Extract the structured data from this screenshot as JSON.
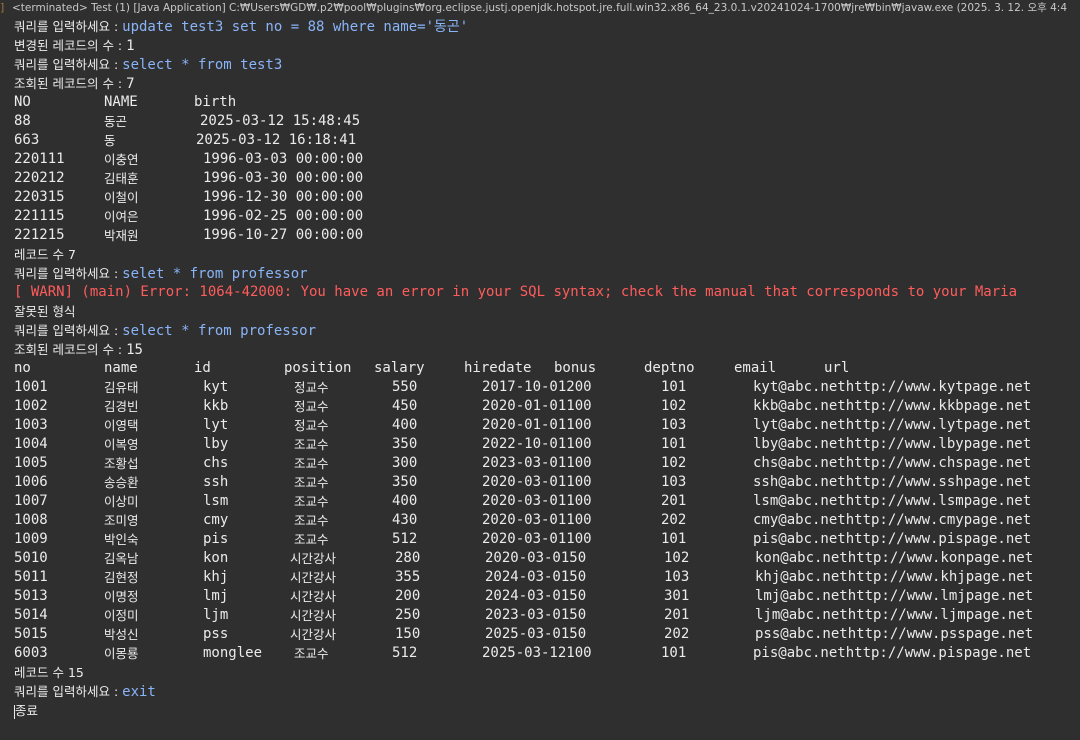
{
  "header": {
    "title": "<terminated> Test (1) [Java Application] C:₩Users₩GD₩.p2₩pool₩plugins₩org.eclipse.justj.openjdk.hotspot.jre.full.win32.x86_64_23.0.1.v20241024-1700₩jre₩bin₩javaw.exe  (2025. 3. 12. 오후 4:4"
  },
  "gutter": {
    "mark": "]"
  },
  "prompt_label": "쿼리를 입력하세요 : ",
  "update_block": {
    "query": "update test3 set no = 88 where name='동곤'",
    "changed_label": "변경된 레코드의 수 : ",
    "changed_count": "1"
  },
  "select_test3": {
    "query": "select * from test3",
    "count_label": "조회된 레코드의 수 : ",
    "count": "7",
    "headers": [
      "NO",
      "NAME",
      "birth"
    ],
    "rows": [
      [
        "88",
        "동곤",
        "2025-03-12 15:48:45"
      ],
      [
        "663",
        "동",
        "2025-03-12 16:18:41"
      ],
      [
        "220111",
        "이충연",
        "1996-03-03 00:00:00"
      ],
      [
        "220212",
        "김태훈",
        "1996-03-30 00:00:00"
      ],
      [
        "220315",
        "이철이",
        "1996-12-30 00:00:00"
      ],
      [
        "221115",
        "이여은",
        "1996-02-25 00:00:00"
      ],
      [
        "221215",
        "박재원",
        "1996-10-27 00:00:00"
      ]
    ],
    "footer": "레코드 수 7"
  },
  "error_block": {
    "query": "selet * from professor",
    "error": "[ WARN] (main) Error: 1064-42000: You have an error in your SQL syntax; check the manual that corresponds to your Maria",
    "message": "잘못된 형식"
  },
  "select_professor": {
    "query": "select * from professor",
    "count_label": "조회된 레코드의 수 : ",
    "count": "15",
    "headers": [
      "no",
      "name",
      "id",
      "position",
      "salary",
      "hiredate",
      "bonus",
      "deptno",
      "email",
      "url"
    ],
    "rows": [
      [
        "1001",
        "김유태",
        "kyt",
        "정교수",
        "550",
        "2017-10-01200",
        "101",
        "kyt@abc.nethttp://www.kytpage.net"
      ],
      [
        "1002",
        "김경빈",
        "kkb",
        "정교수",
        "450",
        "2020-01-01100",
        "102",
        "kkb@abc.nethttp://www.kkbpage.net"
      ],
      [
        "1003",
        "이영택",
        "lyt",
        "정교수",
        "400",
        "2020-01-01100",
        "103",
        "lyt@abc.nethttp://www.lytpage.net"
      ],
      [
        "1004",
        "이복영",
        "lby",
        "조교수",
        "350",
        "2022-10-01100",
        "101",
        "lby@abc.nethttp://www.lbypage.net"
      ],
      [
        "1005",
        "조황섭",
        "chs",
        "조교수",
        "300",
        "2023-03-01100",
        "102",
        "chs@abc.nethttp://www.chspage.net"
      ],
      [
        "1006",
        "송승환",
        "ssh",
        "조교수",
        "350",
        "2020-03-01100",
        "103",
        "ssh@abc.nethttp://www.sshpage.net"
      ],
      [
        "1007",
        "이상미",
        "lsm",
        "조교수",
        "400",
        "2020-03-01100",
        "201",
        "lsm@abc.nethttp://www.lsmpage.net"
      ],
      [
        "1008",
        "조미영",
        "cmy",
        "조교수",
        "430",
        "2020-03-01100",
        "202",
        "cmy@abc.nethttp://www.cmypage.net"
      ],
      [
        "1009",
        "박인숙",
        "pis",
        "조교수",
        "512",
        "2020-03-01100",
        "101",
        "pis@abc.nethttp://www.pispage.net"
      ],
      [
        "5010",
        "김옥남",
        "kon",
        "시간강사",
        "280",
        "2020-03-0150",
        "102",
        "kon@abc.nethttp://www.konpage.net"
      ],
      [
        "5011",
        "김현정",
        "khj",
        "시간강사",
        "355",
        "2024-03-0150",
        "103",
        "khj@abc.nethttp://www.khjpage.net"
      ],
      [
        "5013",
        "이명정",
        "lmj",
        "시간강사",
        "200",
        "2024-03-0150",
        "301",
        "lmj@abc.nethttp://www.lmjpage.net"
      ],
      [
        "5014",
        "이정미",
        "ljm",
        "시간강사",
        "250",
        "2023-03-0150",
        "201",
        "ljm@abc.nethttp://www.ljmpage.net"
      ],
      [
        "5015",
        "박성신",
        "pss",
        "시간강사",
        "150",
        "2025-03-0150",
        "202",
        "pss@abc.nethttp://www.psspage.net"
      ],
      [
        "6003",
        "이몽룡",
        "monglee",
        "조교수",
        "512",
        "2025-03-12100",
        "101",
        "pis@abc.nethttp://www.pispage.net"
      ]
    ],
    "footer": "레코드 수 15"
  },
  "exit_block": {
    "query": "exit",
    "message": "종료"
  },
  "colors": {
    "background": "#2f2f2f",
    "text": "#ebebeb",
    "input": "#8ab4f8",
    "error": "#ff5c5c"
  }
}
